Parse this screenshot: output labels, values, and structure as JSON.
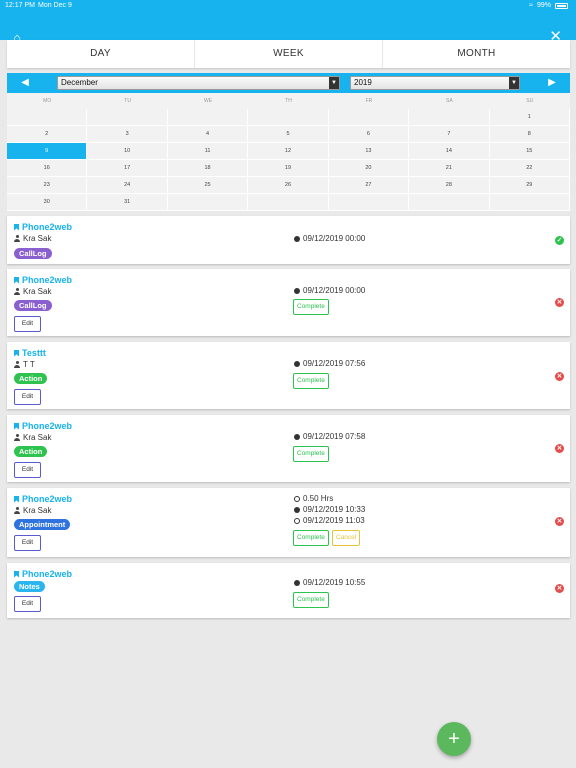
{
  "status_bar": {
    "time": "12:17 PM",
    "date": "Mon Dec 9",
    "battery": "99%"
  },
  "header": {
    "home_icon": "home-icon",
    "close_icon": "close-icon"
  },
  "view_tabs": [
    {
      "label": "DAY"
    },
    {
      "label": "WEEK"
    },
    {
      "label": "MONTH"
    }
  ],
  "calendar": {
    "month": "December",
    "year": "2019",
    "weekdays": [
      "MO",
      "TU",
      "WE",
      "TH",
      "FR",
      "SA",
      "SU"
    ],
    "weeks": [
      [
        "",
        "",
        "",
        "",
        "",
        "",
        "1"
      ],
      [
        "2",
        "3",
        "4",
        "5",
        "6",
        "7",
        "8"
      ],
      [
        "9",
        "10",
        "11",
        "12",
        "13",
        "14",
        "15"
      ],
      [
        "16",
        "17",
        "18",
        "19",
        "20",
        "21",
        "22"
      ],
      [
        "23",
        "24",
        "25",
        "26",
        "27",
        "28",
        "29"
      ],
      [
        "30",
        "31",
        "",
        "",
        "",
        "",
        ""
      ]
    ],
    "selected_day": "9",
    "accent": "#17b3ef"
  },
  "activities": [
    {
      "title": "Phone2web",
      "person": "Kra Sak",
      "badge": "CallLog",
      "datetime": "09/12/2019 00:00",
      "status": "done"
    },
    {
      "title": "Phone2web",
      "person": "Kra Sak",
      "badge": "CallLog",
      "edit": "Edit",
      "datetime": "09/12/2019 00:00",
      "complete": "Complete",
      "status": "open"
    },
    {
      "title": "Testtt",
      "person": "T T",
      "badge": "Action",
      "edit": "Edit",
      "datetime": "09/12/2019 07:56",
      "complete": "Complete",
      "status": "open"
    },
    {
      "title": "Phone2web",
      "person": "Kra Sak",
      "badge": "Action",
      "edit": "Edit",
      "datetime": "09/12/2019 07:58",
      "complete": "Complete",
      "status": "open"
    },
    {
      "title": "Phone2web",
      "person": "Kra Sak",
      "badge": "Appointment",
      "edit": "Edit",
      "duration": "0.50 Hrs",
      "datetime": "09/12/2019 10:33",
      "end_datetime": "09/12/2019 11:03",
      "complete": "Complete",
      "cancel": "Cancel",
      "status": "open"
    },
    {
      "title": "Phone2web",
      "badge": "Notes",
      "edit": "Edit",
      "datetime": "09/12/2019 10:55",
      "complete": "Complete",
      "status": "open"
    }
  ],
  "fab": {
    "label": "+"
  },
  "colors": {
    "calllog": "#8a5fd0",
    "action": "#2ec24f",
    "appointment": "#2f73e0",
    "notes": "#2bb5ef",
    "done": "#2ec24f",
    "open": "#e54b4b"
  }
}
